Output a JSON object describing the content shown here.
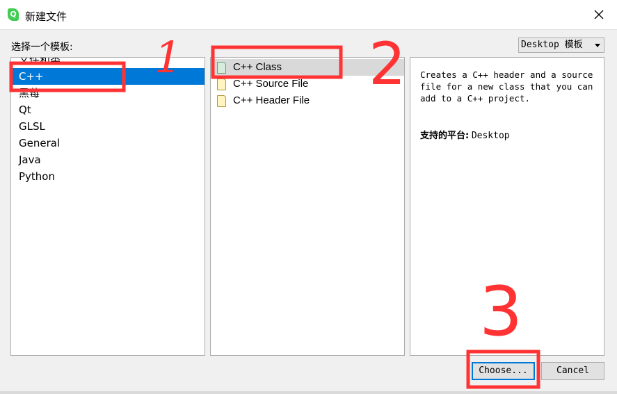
{
  "window": {
    "title": "新建文件",
    "app_icon_glyph": "Q",
    "close_icon": "close-icon"
  },
  "chooser": {
    "label": "选择一个模板:",
    "platform_filter": {
      "selected": "Desktop 模板"
    }
  },
  "categories": {
    "items": [
      {
        "label": "文件和类",
        "selected": false
      },
      {
        "label": "C++",
        "selected": true
      },
      {
        "label": "黑莓",
        "selected": false
      },
      {
        "label": "Qt",
        "selected": false
      },
      {
        "label": "GLSL",
        "selected": false
      },
      {
        "label": "General",
        "selected": false
      },
      {
        "label": "Java",
        "selected": false
      },
      {
        "label": "Python",
        "selected": false
      }
    ]
  },
  "templates": {
    "items": [
      {
        "label": "C++ Class",
        "selected": true,
        "icon": "class-file-icon"
      },
      {
        "label": "C++ Source File",
        "selected": false,
        "icon": "source-file-icon"
      },
      {
        "label": "C++ Header File",
        "selected": false,
        "icon": "header-file-icon"
      }
    ]
  },
  "description": {
    "text": "Creates a C++ header and a source file for a new class that you can add to a C++ project.",
    "platforms_label": "支持的平台:",
    "platforms_value": "Desktop"
  },
  "buttons": {
    "choose": "Choose...",
    "cancel": "Cancel"
  },
  "annotations": {
    "step1": "1",
    "step2": "2",
    "step3": "3",
    "color": "#ff3333"
  },
  "colors": {
    "selection": "#0078d7",
    "template_selection": "#d9d9d9",
    "dialog_bg": "#f0f0f0"
  }
}
